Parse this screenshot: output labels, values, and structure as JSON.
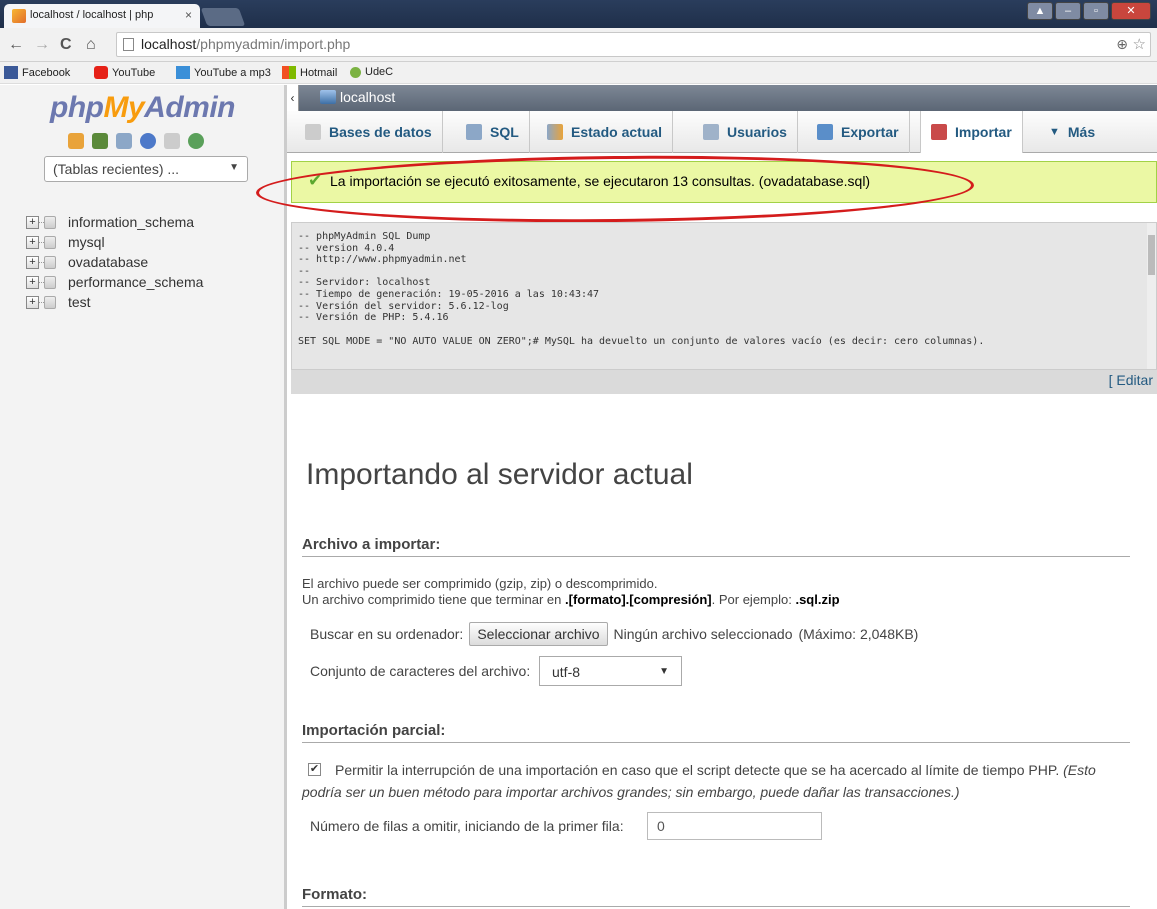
{
  "browser": {
    "tab_title": "localhost / localhost | php",
    "tab_close": "×",
    "url_host": "localhost",
    "url_path": "/phpmyadmin/import.php",
    "zoom_icon": "⊕",
    "star_icon": "☆"
  },
  "bookmarks": [
    {
      "label": "Facebook",
      "color": "#3b5998"
    },
    {
      "label": "YouTube",
      "color": "#e62117"
    },
    {
      "label": "YouTube a mp3",
      "color": "#3a8fd8"
    },
    {
      "label": "Hotmail",
      "color": "#f25022"
    },
    {
      "label": "UdeC",
      "color": "#7bb242"
    }
  ],
  "sidebar": {
    "logo_php": "php",
    "logo_my": "My",
    "logo_admin": "Admin",
    "recent_label": "(Tablas recientes) ...",
    "databases": [
      "information_schema",
      "mysql",
      "ovadatabase",
      "performance_schema",
      "test"
    ]
  },
  "breadcrumb": {
    "server": "localhost"
  },
  "menu": {
    "tabs": [
      "Bases de datos",
      "SQL",
      "Estado actual",
      "Usuarios",
      "Exportar",
      "Importar",
      "Más"
    ],
    "active": "Importar"
  },
  "success_message": "La importación se ejecutó exitosamente, se ejecutaron 13 consultas. (ovadatabase.sql)",
  "sql_dump": [
    "-- phpMyAdmin SQL Dump",
    "-- version 4.0.4",
    "-- http://www.phpmyadmin.net",
    "--",
    "-- Servidor: localhost",
    "-- Tiempo de generación: 19-05-2016 a las 10:43:47",
    "-- Versión del servidor: 5.6.12-log",
    "-- Versión de PHP: 5.4.16",
    "",
    "SET SQL MODE = \"NO AUTO VALUE ON ZERO\";# MySQL ha devuelto un conjunto de valores vacío (es decir: cero columnas)."
  ],
  "edit_link": "[ Editar",
  "main": {
    "heading": "Importando al servidor actual",
    "file_section": "Archivo a importar:",
    "compress_note1": "El archivo puede ser comprimido (gzip, zip) o descomprimido.",
    "compress_note2_a": "Un archivo comprimido tiene que terminar en ",
    "compress_note2_b": ".[formato].[compresión]",
    "compress_note2_c": ". Por ejemplo: ",
    "compress_note2_d": ".sql.zip",
    "browse_label": "Buscar en su ordenador:",
    "browse_button": "Seleccionar archivo",
    "no_file": "Ningún archivo seleccionado",
    "max_size": "(Máximo: 2,048KB)",
    "charset_label": "Conjunto de caracteres del archivo:",
    "charset_value": "utf-8",
    "partial_section": "Importación parcial:",
    "allow_interrupt": "Permitir la interrupción de una importación en caso que el script detecte que se ha acercado al límite de tiempo PHP. ",
    "allow_interrupt_italic_1": "(Esto",
    "allow_interrupt_italic_2": "podría ser un buen método para importar archivos grandes; sin embargo, puede dañar las transacciones.)",
    "skip_rows_label": "Número de filas a omitir, iniciando de la primer fila:",
    "skip_rows_value": "0",
    "format_section": "Formato:"
  }
}
